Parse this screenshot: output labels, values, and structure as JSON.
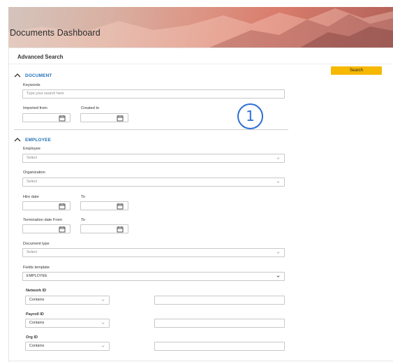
{
  "header": {
    "title": "Documents Dashboard"
  },
  "panel": {
    "title": "Advanced Search"
  },
  "actions": {
    "search_label": "Search"
  },
  "badge": {
    "number": "1"
  },
  "document_section": {
    "heading": "DOCUMENT",
    "keywords_label": "Keywords",
    "keywords_placeholder": "Type your search here",
    "imported_from_label": "Imported from",
    "created_to_label": "Created to"
  },
  "employee_section": {
    "heading": "EMPLOYEE",
    "employee_label": "Employee",
    "employee_value": "Select",
    "organization_label": "Organization",
    "organization_value": "Select",
    "hire_date_label": "Hire date",
    "hire_to_label": "To",
    "termination_label": "Termination date From",
    "termination_to_label": "To",
    "doc_type_label": "Document type",
    "doc_type_value": "Select",
    "fields_template_label": "Fields template",
    "fields_template_value": "EMPLOYEE",
    "filters": [
      {
        "label": "Network ID",
        "operator": "Contains",
        "value": ""
      },
      {
        "label": "Payroll ID",
        "operator": "Contains",
        "value": ""
      },
      {
        "label": "Org ID",
        "operator": "Contains",
        "value": ""
      }
    ]
  },
  "colors": {
    "accent": "#f6b800",
    "link": "#1f6fb5",
    "badge": "#2d6ed4"
  },
  "icons": [
    "chevron-up-icon",
    "calendar-icon",
    "chevron-down-icon"
  ]
}
